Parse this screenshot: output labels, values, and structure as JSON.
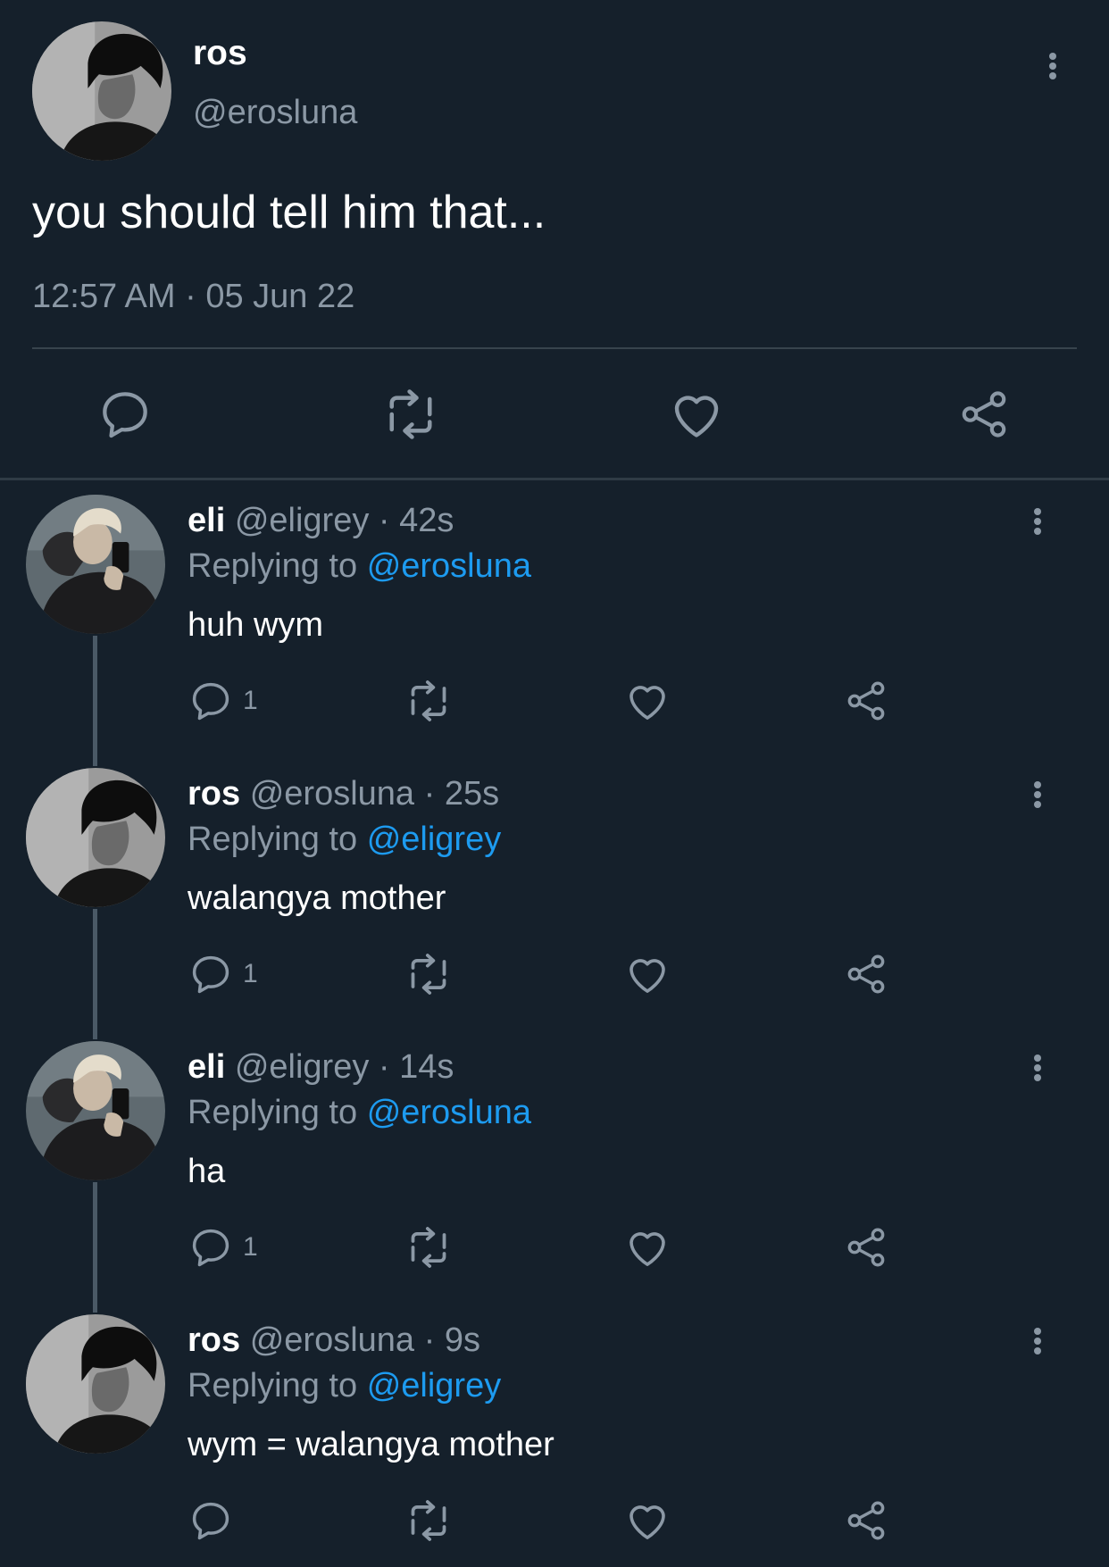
{
  "main_tweet": {
    "display_name": "ros",
    "handle": "@erosluna",
    "text": "you should tell him that...",
    "timestamp": "12:57 AM · 05 Jun 22",
    "avatar_icon": "avatar-dark-hair",
    "actions": [
      "reply-icon",
      "retweet-icon",
      "like-icon",
      "share-icon"
    ]
  },
  "replies": [
    {
      "display_name": "eli",
      "handle": "@eligrey",
      "age": "· 42s",
      "replying_prefix": "Replying to",
      "replying_to": "@erosluna",
      "text": "huh wym",
      "reply_count": "1",
      "avatar_icon": "avatar-blonde-selfie"
    },
    {
      "display_name": "ros",
      "handle": "@erosluna",
      "age": "· 25s",
      "replying_prefix": "Replying to",
      "replying_to": "@eligrey",
      "text": "walangya mother",
      "reply_count": "1",
      "avatar_icon": "avatar-dark-hair"
    },
    {
      "display_name": "eli",
      "handle": "@eligrey",
      "age": "· 14s",
      "replying_prefix": "Replying to",
      "replying_to": "@erosluna",
      "text": "ha",
      "reply_count": "1",
      "avatar_icon": "avatar-blonde-selfie"
    },
    {
      "display_name": "ros",
      "handle": "@erosluna",
      "age": "· 9s",
      "replying_prefix": "Replying to",
      "replying_to": "@eligrey",
      "text": "wym = walangya mother",
      "reply_count": "",
      "avatar_icon": "avatar-dark-hair"
    }
  ],
  "colors": {
    "background": "#15202b",
    "text": "#ffffff",
    "muted": "#8b98a5",
    "link": "#1d9bf0",
    "divider": "#38444d"
  }
}
